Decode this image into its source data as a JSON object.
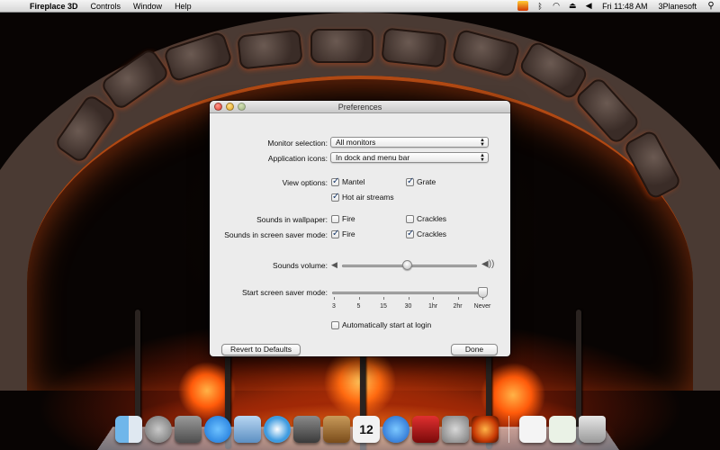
{
  "menubar": {
    "apple_icon": "apple-icon",
    "app_name": "Fireplace 3D",
    "menus": [
      "Controls",
      "Window",
      "Help"
    ],
    "status_icons": [
      "fire-status-icon",
      "bluetooth-icon",
      "wifi-icon",
      "eject-icon",
      "volume-icon"
    ],
    "clock": "Fri 11:48 AM",
    "user": "3Planesoft",
    "spotlight_icon": "spotlight-icon"
  },
  "window": {
    "title": "Preferences",
    "monitor_label": "Monitor selection:",
    "monitor_value": "All monitors",
    "icons_label": "Application icons:",
    "icons_value": "In dock and menu bar",
    "view_label": "View options:",
    "view_options": [
      {
        "label": "Mantel",
        "checked": true
      },
      {
        "label": "Grate",
        "checked": true
      },
      {
        "label": "Hot air streams",
        "checked": true
      }
    ],
    "sounds_wallpaper_label": "Sounds in wallpaper:",
    "sounds_wallpaper": [
      {
        "label": "Fire",
        "checked": false
      },
      {
        "label": "Crackles",
        "checked": false
      }
    ],
    "sounds_saver_label": "Sounds in screen saver mode:",
    "sounds_saver": [
      {
        "label": "Fire",
        "checked": true
      },
      {
        "label": "Crackles",
        "checked": true
      }
    ],
    "volume_label": "Sounds volume:",
    "volume_level": 0.48,
    "saver_label": "Start screen saver mode:",
    "saver_ticks": [
      "3",
      "5",
      "15",
      "30",
      "1hr",
      "2hr",
      "Never"
    ],
    "saver_selected": "Never",
    "auto_start": {
      "label": "Automatically start at login",
      "checked": false
    },
    "revert_button": "Revert to Defaults",
    "done_button": "Done"
  },
  "dock": {
    "icons": [
      "finder-icon",
      "launchpad-icon",
      "image-capture-icon",
      "app-store-icon",
      "preview-icon",
      "safari-icon",
      "facetime-icon",
      "address-book-icon",
      "calendar-icon",
      "itunes-icon",
      "photo-booth-icon",
      "system-preferences-icon",
      "fireplace-3d-icon"
    ],
    "calendar_date": "12",
    "right_icons": [
      "document-icon",
      "downloads-icon",
      "trash-icon"
    ]
  },
  "colors": {
    "window_bg": "#ececec",
    "fire_glow": "#ff6a10",
    "stone": "#4a3a33"
  }
}
